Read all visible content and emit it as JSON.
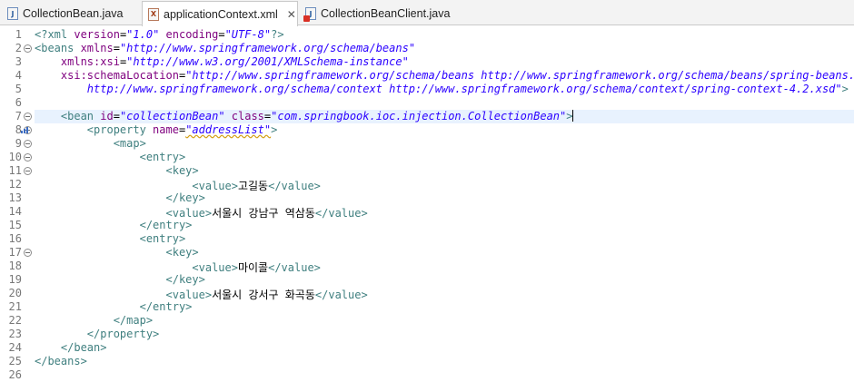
{
  "tabs": [
    {
      "label": "CollectionBean.java",
      "icon": "java-file-icon",
      "active": false
    },
    {
      "label": "applicationContext.xml",
      "icon": "xml-file-icon",
      "active": true,
      "close": "✕"
    },
    {
      "label": "CollectionBeanClient.java",
      "icon": "java-file-error-icon",
      "active": false
    }
  ],
  "editor": {
    "line_numbers": [
      "1",
      "2",
      "3",
      "4",
      "5",
      "6",
      "7",
      "8",
      "9",
      "10",
      "11",
      "12",
      "13",
      "14",
      "15",
      "16",
      "17",
      "18",
      "19",
      "20",
      "21",
      "22",
      "23",
      "24",
      "25",
      "26"
    ],
    "lines": [
      [
        [
          "pi",
          "<?xml "
        ],
        [
          "attr",
          "version"
        ],
        [
          "txt",
          "="
        ],
        [
          "val",
          "\"1.0\""
        ],
        [
          "txt",
          " "
        ],
        [
          "attr",
          "encoding"
        ],
        [
          "txt",
          "="
        ],
        [
          "val",
          "\"UTF-8\""
        ],
        [
          "pi",
          "?>"
        ]
      ],
      [
        [
          "tag",
          "<beans "
        ],
        [
          "attr",
          "xmlns"
        ],
        [
          "txt",
          "="
        ],
        [
          "val",
          "\"http://www.springframework.org/schema/beans\""
        ]
      ],
      [
        [
          "txt",
          "    "
        ],
        [
          "attr",
          "xmlns:xsi"
        ],
        [
          "txt",
          "="
        ],
        [
          "val",
          "\"http://www.w3.org/2001/XMLSchema-instance\""
        ]
      ],
      [
        [
          "txt",
          "    "
        ],
        [
          "attr",
          "xsi:schemaLocation"
        ],
        [
          "txt",
          "="
        ],
        [
          "val",
          "\"http://www.springframework.org/schema/beans http://www.springframework.org/schema/beans/spring-beans.xsd"
        ]
      ],
      [
        [
          "txt",
          "        "
        ],
        [
          "val",
          "http://www.springframework.org/schema/context http://www.springframework.org/schema/context/spring-context-4.2.xsd\""
        ],
        [
          "tag",
          ">"
        ]
      ],
      [],
      [
        [
          "txt",
          "    "
        ],
        [
          "tag",
          "<bean "
        ],
        [
          "attr",
          "id"
        ],
        [
          "txt",
          "="
        ],
        [
          "val",
          "\"collectionBean\""
        ],
        [
          "txt",
          " "
        ],
        [
          "attr",
          "class"
        ],
        [
          "txt",
          "="
        ],
        [
          "val",
          "\"com.springbook.ioc.injection.CollectionBean\""
        ],
        [
          "tag",
          ">"
        ],
        [
          "caret",
          ""
        ]
      ],
      [
        [
          "txt",
          "        "
        ],
        [
          "tag",
          "<property "
        ],
        [
          "attr",
          "name"
        ],
        [
          "txt",
          "="
        ],
        [
          "valsq",
          "\"addressList\""
        ],
        [
          "tag",
          ">"
        ]
      ],
      [
        [
          "txt",
          "            "
        ],
        [
          "tag",
          "<map>"
        ]
      ],
      [
        [
          "txt",
          "                "
        ],
        [
          "tag",
          "<entry>"
        ]
      ],
      [
        [
          "txt",
          "                    "
        ],
        [
          "tag",
          "<key>"
        ]
      ],
      [
        [
          "txt",
          "                        "
        ],
        [
          "tag",
          "<value>"
        ],
        [
          "txt",
          "고길동"
        ],
        [
          "tag",
          "</value>"
        ]
      ],
      [
        [
          "txt",
          "                    "
        ],
        [
          "tag",
          "</key>"
        ]
      ],
      [
        [
          "txt",
          "                    "
        ],
        [
          "tag",
          "<value>"
        ],
        [
          "txt",
          "서울시 강남구 역삼동"
        ],
        [
          "tag",
          "</value>"
        ]
      ],
      [
        [
          "txt",
          "                "
        ],
        [
          "tag",
          "</entry>"
        ]
      ],
      [
        [
          "txt",
          "                "
        ],
        [
          "tag",
          "<entry>"
        ]
      ],
      [
        [
          "txt",
          "                    "
        ],
        [
          "tag",
          "<key>"
        ]
      ],
      [
        [
          "txt",
          "                        "
        ],
        [
          "tag",
          "<value>"
        ],
        [
          "txt",
          "마이콜"
        ],
        [
          "tag",
          "</value>"
        ]
      ],
      [
        [
          "txt",
          "                    "
        ],
        [
          "tag",
          "</key>"
        ]
      ],
      [
        [
          "txt",
          "                    "
        ],
        [
          "tag",
          "<value>"
        ],
        [
          "txt",
          "서울시 강서구 화곡동"
        ],
        [
          "tag",
          "</value>"
        ]
      ],
      [
        [
          "txt",
          "                "
        ],
        [
          "tag",
          "</entry>"
        ]
      ],
      [
        [
          "txt",
          "            "
        ],
        [
          "tag",
          "</map>"
        ]
      ],
      [
        [
          "txt",
          "        "
        ],
        [
          "tag",
          "</property>"
        ]
      ],
      [
        [
          "txt",
          "    "
        ],
        [
          "tag",
          "</bean>"
        ]
      ],
      [
        [
          "tag",
          "</beans>"
        ]
      ],
      []
    ],
    "fold_lines": [
      2,
      7,
      8,
      9,
      10,
      11,
      17
    ],
    "current_line": 7,
    "colors": {
      "tag": "#3f7f7f",
      "attr": "#7f007f",
      "value": "#2a00ff",
      "current_line_bg": "#e8f2fe"
    }
  }
}
